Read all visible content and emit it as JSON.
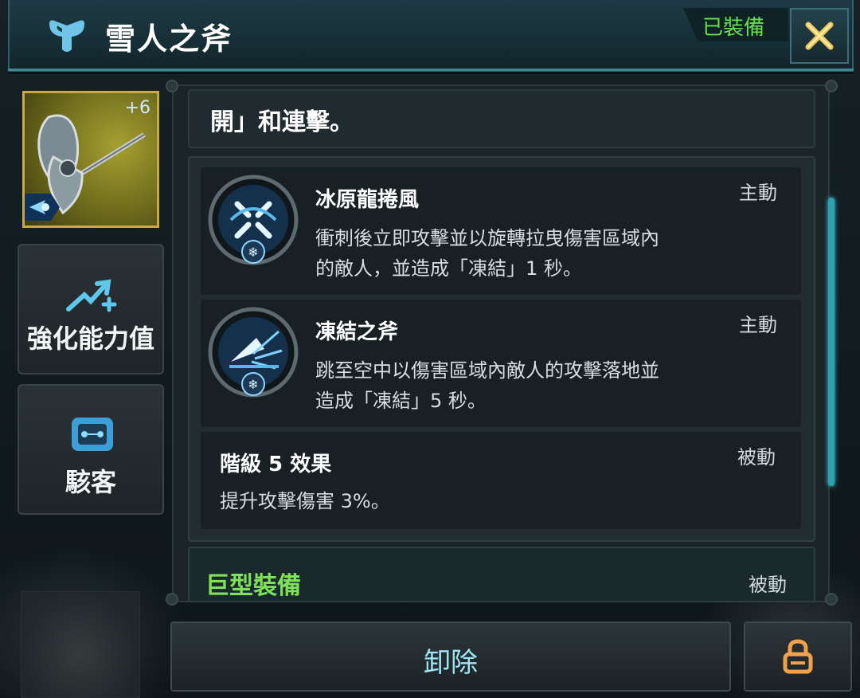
{
  "header": {
    "title": "雪人之斧",
    "status": "已裝備",
    "status_color": "#66e24a",
    "accent_color": "#3f8896"
  },
  "item": {
    "enhance_level": "+6"
  },
  "sidebar": {
    "enhance_label": "強化能力值",
    "hacker_label": "駭客"
  },
  "main": {
    "top_text": "開」和連擊。",
    "skills": [
      {
        "name": "冰原龍捲風",
        "type": "主動",
        "desc_line1": "衝刺後立即攻擊並以旋轉拉曳傷害區域內",
        "desc_line2": "的敵人，並造成「凍結」1 秒。",
        "icon": "tornado-skill-icon"
      },
      {
        "name": "凍結之斧",
        "type": "主動",
        "desc_line1": "跳至空中以傷害區域內敵人的攻擊落地並",
        "desc_line2": "造成「凍結」5 秒。",
        "icon": "axe-slam-skill-icon"
      }
    ],
    "passive": {
      "name": "階級 5 效果",
      "type": "被動",
      "desc": "提升攻擊傷害 3%。"
    },
    "bottom_section": {
      "title": "巨型裝備",
      "type": "被動",
      "title_color": "#7fe05a"
    }
  },
  "footer": {
    "unload_label": "卸除",
    "lock_icon": "lock-icon"
  }
}
